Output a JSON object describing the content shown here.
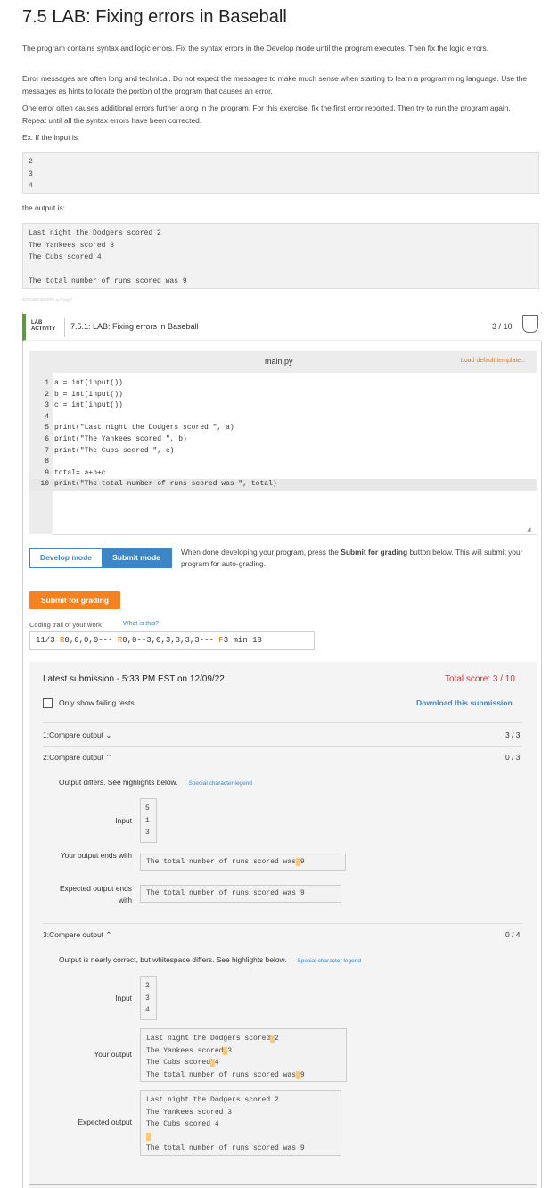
{
  "page": {
    "title": "7.5 LAB: Fixing errors in Baseball",
    "paragraphs": [
      "The program contains syntax and logic errors. Fix the syntax errors in the Develop mode until the program executes. Then fix the logic errors.",
      "Error messages are often long and technical. Do not expect the messages to make much sense when starting to learn a programming language. Use the messages as hints to locate the portion of the program that causes an error.",
      "One error often causes additional errors further along in the program. For this exercise, fix the first error reported. Then try to run the program again. Repeat until all the syntax errors have been corrected.",
      "Ex: If the input is:"
    ],
    "example_input": [
      "2",
      "3",
      "4"
    ],
    "output_label": "the output is:",
    "example_output": [
      "Last night the Dodgers scored 2",
      "The Yankees scored 3",
      "The Cubs scored 4",
      "",
      "The total number of runs scored was 9"
    ],
    "id_tag": "4280482485056.qx3zqy7"
  },
  "lab": {
    "activity_label": "LAB\nACTIVITY",
    "title": "7.5.1: LAB: Fixing errors in Baseball",
    "score": "3 / 10",
    "filename": "main.py",
    "load_template": "Load default template...",
    "code_lines": [
      "a = int(input())",
      "b = int(input())",
      "c = int(input())",
      "",
      "print(\"Last night the Dodgers scored \", a)",
      "print(\"The Yankees scored \", b)",
      "print(\"The Cubs scored \", c)",
      "",
      "total= a+b+c",
      "print(\"The total number of runs scored was \", total)"
    ],
    "line_numbers": [
      "1",
      "2",
      "3",
      "4",
      "5",
      "6",
      "7",
      "8",
      "9",
      "10"
    ],
    "develop_mode": "Develop mode",
    "submit_mode": "Submit mode",
    "mode_note_pre": "When done developing your program, press the ",
    "mode_note_bold": "Submit for grading",
    "mode_note_post": " button below. This will submit your program for auto-grading.",
    "submit_button": "Submit for grading",
    "trail_label": "Coding trail of your work",
    "trail_what": "What is this?",
    "trail_parts": [
      "11/3 ",
      "R",
      "0,0,0,0--- ",
      "R",
      "0,0--3,0,3,3,3,3--- ",
      "F",
      "3 min:18"
    ]
  },
  "results": {
    "latest": "Latest submission - 5:33 PM EST on 12/09/22",
    "total_score": "Total score: 3 / 10",
    "only_failing": "Only show failing tests",
    "download": "Download this submission",
    "tests": [
      {
        "label": "1:Compare output",
        "chevron": "⌄",
        "score": "3 / 3"
      },
      {
        "label": "2:Compare output",
        "chevron": "⌃",
        "score": "0 / 3",
        "note": "Output differs. See highlights below.",
        "legend": "Special character legend",
        "input_label": "Input",
        "input": [
          "5",
          "1",
          "3"
        ],
        "yours_label": "Your output ends with",
        "yours_pre": "The total number of runs scored was",
        "yours_post": "9",
        "expected_label": "Expected output ends with",
        "expected": "The total number of runs scored was 9"
      },
      {
        "label": "3:Compare output",
        "chevron": "⌃",
        "score": "0 / 4",
        "note": "Output is nearly correct, but whitespace differs. See highlights below.",
        "legend": "Special character legend",
        "input_label": "Input",
        "input": [
          "2",
          "3",
          "4"
        ],
        "yours_label": "Your output",
        "yours_lines": [
          {
            "pre": "Last night the Dodgers scored",
            "post": "2"
          },
          {
            "pre": "The Yankees scored",
            "post": "3"
          },
          {
            "pre": "The Cubs scored",
            "post": "4"
          },
          {
            "pre": "The total number of runs scored was",
            "post": "9"
          }
        ],
        "expected_label": "Expected output",
        "expected_lines": [
          "Last night the Dodgers scored 2",
          "The Yankees scored 3",
          "The Cubs scored 4",
          "",
          "The total number of runs scored was 9"
        ]
      }
    ]
  },
  "colors": {
    "accent": "#3d86c6",
    "orange": "#f58220",
    "error": "#d03030",
    "highlight": "#f7c97a",
    "lab_green": "#5a9a41"
  }
}
